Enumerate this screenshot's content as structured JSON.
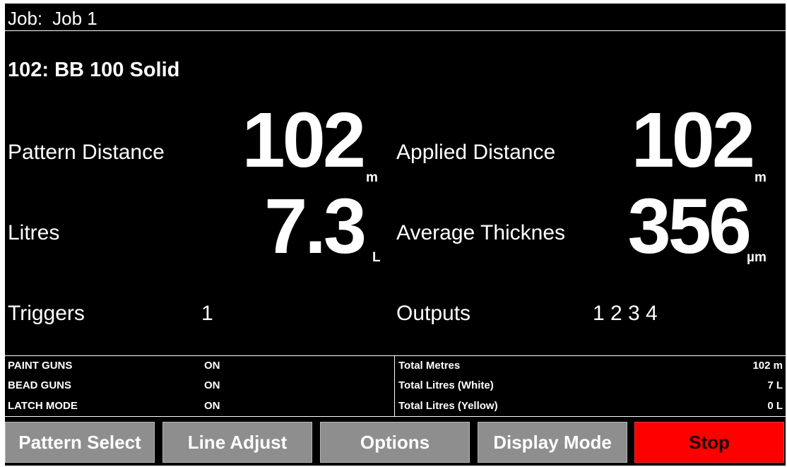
{
  "header": {
    "job_label": "Job:",
    "job_name": "Job 1"
  },
  "pattern": {
    "name": "102: BB 100 Solid"
  },
  "metrics": {
    "pattern_distance": {
      "label": "Pattern Distance",
      "value": "102",
      "unit": "m"
    },
    "applied_distance": {
      "label": "Applied Distance",
      "value": "102",
      "unit": "m"
    },
    "litres": {
      "label": "Litres",
      "value": "7.3",
      "unit": "L"
    },
    "average_thickness": {
      "label": "Average Thicknes",
      "value": "356",
      "unit": "µm"
    },
    "triggers": {
      "label": "Triggers",
      "value": "1"
    },
    "outputs": {
      "label": "Outputs",
      "value": "1 2 3 4"
    }
  },
  "status_left": [
    {
      "key": "PAINT GUNS",
      "value": "ON"
    },
    {
      "key": "BEAD GUNS",
      "value": "ON"
    },
    {
      "key": "LATCH MODE",
      "value": "ON"
    }
  ],
  "status_right": [
    {
      "key": "Total Metres",
      "value": "102 m"
    },
    {
      "key": "Total Litres (White)",
      "value": "7 L"
    },
    {
      "key": "Total Litres (Yellow)",
      "value": "0 L"
    }
  ],
  "buttons": {
    "pattern_select": "Pattern Select",
    "line_adjust": "Line Adjust",
    "options": "Options",
    "display_mode": "Display Mode",
    "stop": "Stop"
  },
  "colors": {
    "background": "#000000",
    "button_gray": "#8e8e8e",
    "stop_red": "#ff0000"
  }
}
